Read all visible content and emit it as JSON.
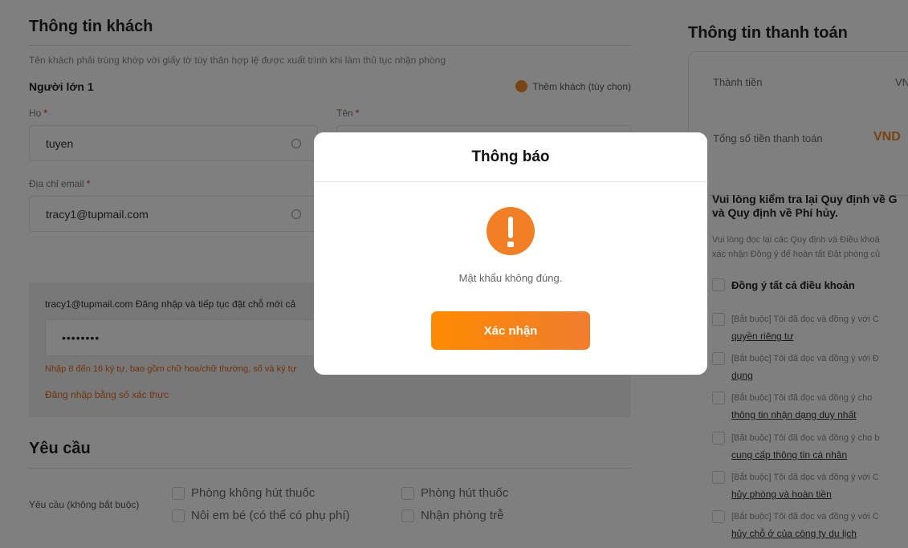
{
  "guest_info": {
    "title": "Thông tin khách",
    "hint": "Tên khách phải trùng khớp với giấy tờ tùy thân hợp lệ được xuất trình khi làm thủ tục nhận phòng",
    "adult_label": "Người lớn 1",
    "add_guest_label": "Thêm khách (tùy chọn)",
    "last_name_label": "Họ",
    "first_name_label": "Tên",
    "last_name_value": "tuyen",
    "email_label": "Địa chỉ email",
    "email_value": "tracy1@tupmail.com",
    "login_message": "tracy1@tupmail.com Đăng nhập và tiếp tục đặt chỗ mới cả",
    "password_value": "••••••••",
    "password_error": "Nhập 8 đến 16 ký tự, bao gồm chữ hoa/chữ thường, số và ký tự",
    "alt_login_link": "Đăng nhập bằng số xác thực"
  },
  "requests": {
    "title": "Yêu cầu",
    "label": "Yêu cầu (không bắt buộc)",
    "options": [
      "Phòng không hút thuốc",
      "Phòng hút thuốc",
      "Nôi em bé (có thể có phụ phí)",
      "Nhận phòng trễ"
    ]
  },
  "payment": {
    "title": "Thông tin thanh toán",
    "subtotal_label": "Thành tiền",
    "subtotal_value": "VN",
    "total_label": "Tổng số tiền thanh toán",
    "total_value": "VND",
    "policy_title_line1": "Vui lòng kiểm tra lại Quy định về G",
    "policy_title_line2": "và Quy định về Phí hủy.",
    "policy_desc_line1": "Vui lòng đọc lại các Quy định và Điều khoả",
    "policy_desc_line2": "xác nhận Đồng ý để hoàn tất Đặt phòng củ",
    "agree_all_label": "Đồng ý tất cả điều khoản",
    "terms": [
      {
        "prefix": "[Bắt buộc] Tôi đã đọc và đồng ý với C",
        "link": "quyền riêng tư"
      },
      {
        "prefix": "[Bắt buộc] Tôi đã đọc và đồng ý với Đ",
        "link": "dụng"
      },
      {
        "prefix": "[Bắt buộc] Tôi đã đọc và đồng ý cho ",
        "link": "thông tin nhận dạng duy nhất"
      },
      {
        "prefix": "[Bắt buộc] Tôi đã đọc và đồng ý cho b",
        "link": "cung cấp thông tin cá nhân"
      },
      {
        "prefix": "[Bắt buộc] Tôi đã đọc và đồng ý với C",
        "link": "hủy phòng và hoàn tiền"
      },
      {
        "prefix": "[Bắt buộc] Tôi đã đọc và đồng ý với C",
        "link": "hủy chỗ ở của công ty du lịch"
      }
    ]
  },
  "modal": {
    "title": "Thông báo",
    "icon": "exclamation-icon",
    "message": "Mật khẩu không đúng.",
    "confirm_label": "Xác nhận"
  },
  "colors": {
    "accent": "#f07f25",
    "overlay": "rgba(0,0,0,0.5)",
    "error_text": "#e0691a"
  }
}
